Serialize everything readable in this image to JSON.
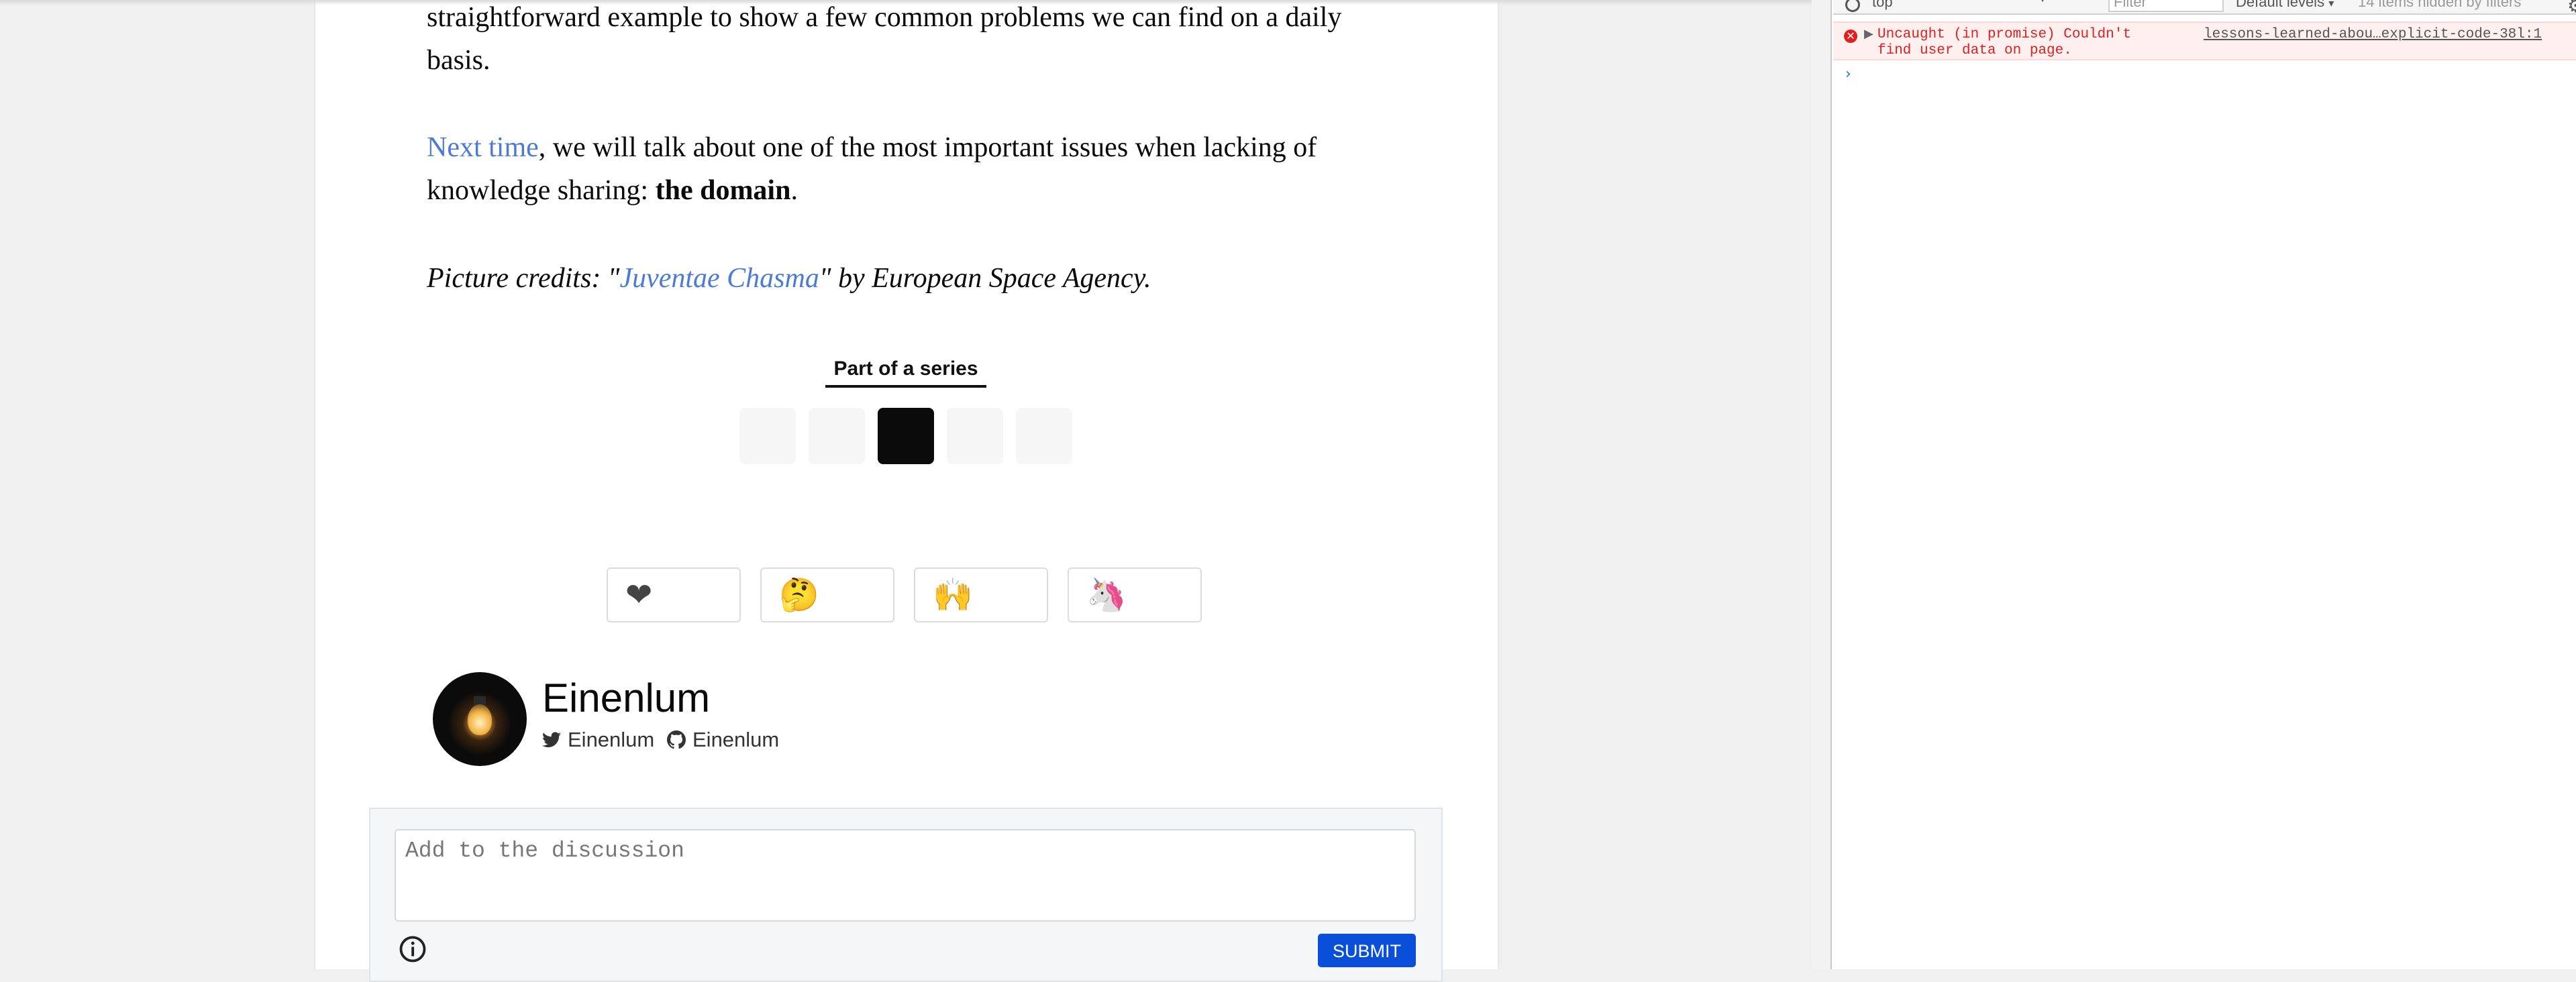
{
  "article": {
    "p1_text": "straightforward example to show a few common problems we can find on a daily basis.",
    "p2_link": "Next time",
    "p2_text": ", we will talk about one of the most important issues when lacking of knowledge sharing: ",
    "p2_bold": "the domain",
    "p2_end": ".",
    "p3_prefix": "Picture credits: \"",
    "p3_link": "Juventae Chasma",
    "p3_suffix": "\" by European Space Agency."
  },
  "series": {
    "title": "Part of a series",
    "items": [
      {
        "active": false
      },
      {
        "active": false
      },
      {
        "active": true
      },
      {
        "active": false
      },
      {
        "active": false
      }
    ]
  },
  "reactions": [
    {
      "icon": "heart-icon",
      "glyph": "❤"
    },
    {
      "icon": "thinking-icon",
      "glyph": "🤔"
    },
    {
      "icon": "raised-hands-icon",
      "glyph": "🙌"
    },
    {
      "icon": "unicorn-icon",
      "glyph": "🦄"
    }
  ],
  "author": {
    "name": "Einenlum",
    "twitter": "Einenlum",
    "github": "Einenlum"
  },
  "comment": {
    "placeholder": "Add to the discussion",
    "submit_label": "SUBMIT"
  },
  "devtools": {
    "context": "top",
    "filter_placeholder": "Filter",
    "levels": "Default levels",
    "hidden": "14 items hidden by filters",
    "error_message": "Uncaught (in promise) Couldn't find user data on page.",
    "error_source": "lessons-learned-abou…explicit-code-38l:1",
    "prompt": "›",
    "colors": {
      "error": "#e0201f",
      "prompt": "#1a73e8"
    }
  }
}
